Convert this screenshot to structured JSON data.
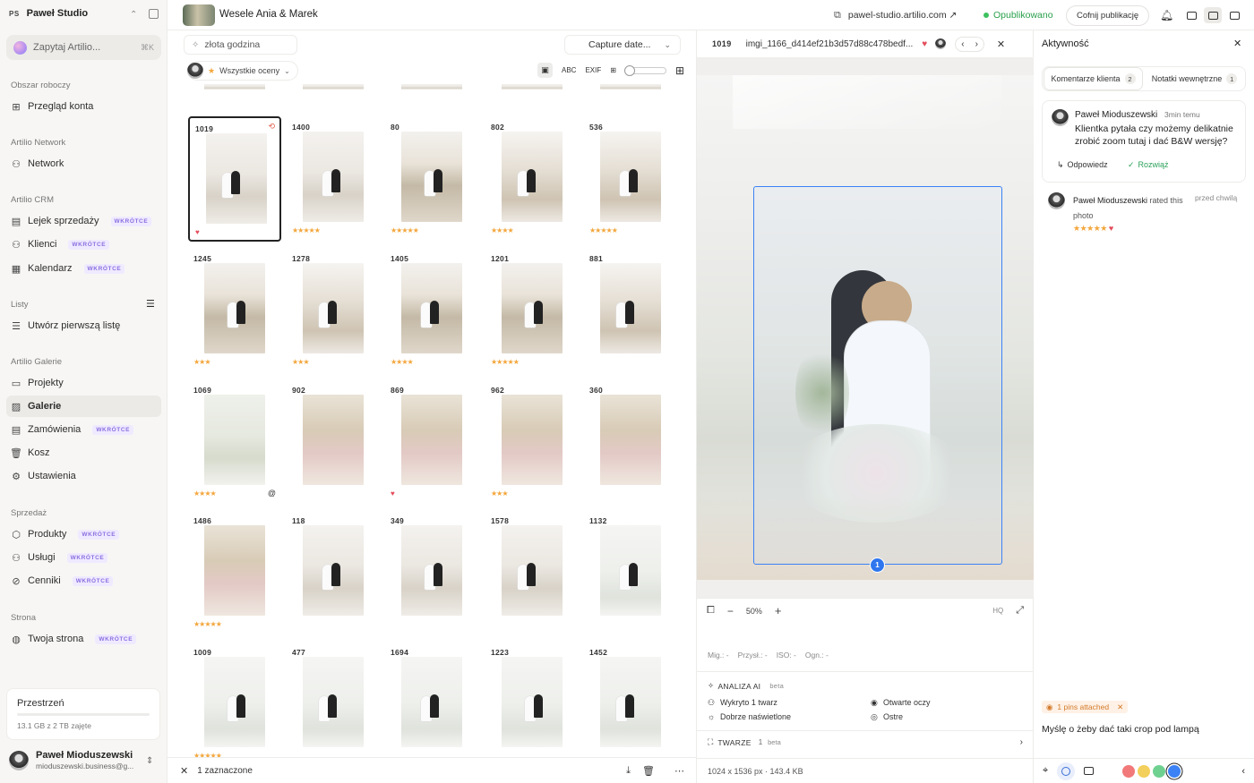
{
  "sidebar": {
    "workspace_initials": "PS",
    "workspace_name": "Paweł Studio",
    "ask_label": "Zapytaj Artilio...",
    "ask_shortcut": "⌘K",
    "sections": [
      {
        "title": "Obszar roboczy",
        "items": [
          {
            "label": "Przegląd konta",
            "icon": "grid-icon"
          }
        ]
      },
      {
        "title": "Artilio Network",
        "items": [
          {
            "label": "Network",
            "icon": "people-icon"
          }
        ]
      },
      {
        "title": "Artilio CRM",
        "items": [
          {
            "label": "Lejek sprzedaży",
            "icon": "funnel-icon",
            "soon": "WKRÓTCE"
          },
          {
            "label": "Klienci",
            "icon": "people-icon",
            "soon": "WKRÓTCE"
          },
          {
            "label": "Kalendarz",
            "icon": "calendar-icon",
            "soon": "WKRÓTCE"
          }
        ]
      },
      {
        "title": "Listy",
        "items": [
          {
            "label": "Utwórz pierwszą listę",
            "icon": "list-icon"
          }
        ]
      },
      {
        "title": "Artilio Galerie",
        "items": [
          {
            "label": "Projekty",
            "icon": "folder-icon"
          },
          {
            "label": "Galerie",
            "icon": "gallery-icon",
            "active": true
          },
          {
            "label": "Zamówienia",
            "icon": "orders-icon",
            "soon": "WKRÓTCE"
          },
          {
            "label": "Kosz",
            "icon": "trash-icon"
          },
          {
            "label": "Ustawienia",
            "icon": "gear-icon"
          }
        ]
      },
      {
        "title": "Sprzedaż",
        "items": [
          {
            "label": "Produkty",
            "icon": "box-icon",
            "soon": "WKRÓTCE"
          },
          {
            "label": "Usługi",
            "icon": "people-icon",
            "soon": "WKRÓTCE"
          },
          {
            "label": "Cenniki",
            "icon": "tag-icon",
            "soon": "WKRÓTCE"
          }
        ]
      },
      {
        "title": "Strona",
        "items": [
          {
            "label": "Twoja strona",
            "icon": "globe-icon",
            "soon": "WKRÓTCE"
          }
        ]
      }
    ],
    "storage_title": "Przestrzeń",
    "storage_used": "13.1 GB z 2 TB zajęte",
    "user_name": "Paweł Mioduszewski",
    "user_email": "mioduszewski.business@g..."
  },
  "topbar": {
    "gallery_title": "Wesele Ania & Marek",
    "url": "pawel-studio.artilio.com ↗",
    "status": "Opublikowano",
    "unpublish": "Cofnij publikację"
  },
  "gallery": {
    "search_value": "złota godzina",
    "sort_label": "Capture date...",
    "filter_label": "Wszystkie oceny",
    "view_abc": "ABC",
    "view_exif": "EXIF",
    "selected_text": "1 zaznaczone",
    "photos": [
      {
        "num": "1019",
        "rating": 0,
        "heart": true,
        "selected": true,
        "edit": true,
        "style": "ph1"
      },
      {
        "num": "1400",
        "rating": 5,
        "style": "ph1"
      },
      {
        "num": "80",
        "rating": 5,
        "style": "ph3"
      },
      {
        "num": "802",
        "rating": 4,
        "style": "ph2"
      },
      {
        "num": "536",
        "rating": 5,
        "style": "ph2"
      },
      {
        "num": "1245",
        "rating": 3,
        "style": "ph3"
      },
      {
        "num": "1278",
        "rating": 3,
        "style": "ph2"
      },
      {
        "num": "1405",
        "rating": 4,
        "style": "ph3"
      },
      {
        "num": "1201",
        "rating": 5,
        "style": "ph3"
      },
      {
        "num": "881",
        "rating": 0,
        "style": "ph2"
      },
      {
        "num": "1069",
        "rating": 4,
        "at": true,
        "style": "ph4"
      },
      {
        "num": "902",
        "rating": 0,
        "style": "ph5"
      },
      {
        "num": "869",
        "rating": 0,
        "heart": true,
        "style": "ph5"
      },
      {
        "num": "962",
        "rating": 3,
        "style": "ph5"
      },
      {
        "num": "360",
        "rating": 0,
        "style": "ph5"
      },
      {
        "num": "1486",
        "rating": 5,
        "style": "ph5"
      },
      {
        "num": "118",
        "rating": 0,
        "style": "ph1"
      },
      {
        "num": "349",
        "rating": 0,
        "style": "ph1"
      },
      {
        "num": "1578",
        "rating": 0,
        "style": "ph1"
      },
      {
        "num": "1132",
        "rating": 0,
        "style": "ph6"
      },
      {
        "num": "1009",
        "rating": 5,
        "style": "ph6"
      },
      {
        "num": "477",
        "rating": 0,
        "style": "ph6"
      },
      {
        "num": "1694",
        "rating": 0,
        "style": "ph6"
      },
      {
        "num": "1223",
        "rating": 0,
        "style": "ph6"
      },
      {
        "num": "1452",
        "rating": 0,
        "style": "ph6"
      }
    ]
  },
  "viewer": {
    "photo_number": "1019",
    "filename": "imgi_1166_d414ef21b3d57d88c478bedf...",
    "zoom": "50%",
    "hq": "HQ",
    "pin_number": "1",
    "exif": [
      "Mig.: -",
      "Przysł.: -",
      "ISO: -",
      "Ogn.: -"
    ],
    "ai_title": "ANALIZA AI",
    "beta": "beta",
    "ai_items": [
      "Wykryto 1 twarz",
      "Otwarte oczy",
      "Dobrze naświetlone",
      "Ostre"
    ],
    "faces_label": "TWARZE",
    "faces_count": "1",
    "dimensions": "1024 x 1536 px · 143.4 KB"
  },
  "activity": {
    "title": "Aktywność",
    "tab_client": "Komentarze klienta",
    "tab_client_count": "2",
    "tab_internal": "Notatki wewnętrzne",
    "tab_internal_count": "1",
    "comment_author": "Paweł Mioduszewski",
    "comment_time": "3min temu",
    "comment_text": "Klientka pytała czy możemy delikatnie zrobić zoom tutaj i dać B&W wersję?",
    "reply": "Odpowiedz",
    "resolve": "Rozwiąż",
    "rated_author": "Paweł Mioduszewski",
    "rated_text": "rated this",
    "rated_time": "przed chwilą",
    "rated_word": "photo",
    "pins_attached": "1 pins attached",
    "message": "Myślę o żeby dać taki crop pod lampą",
    "colors": [
      "#f27979",
      "#f3cf5b",
      "#6fd190",
      "#3b82f6"
    ]
  }
}
